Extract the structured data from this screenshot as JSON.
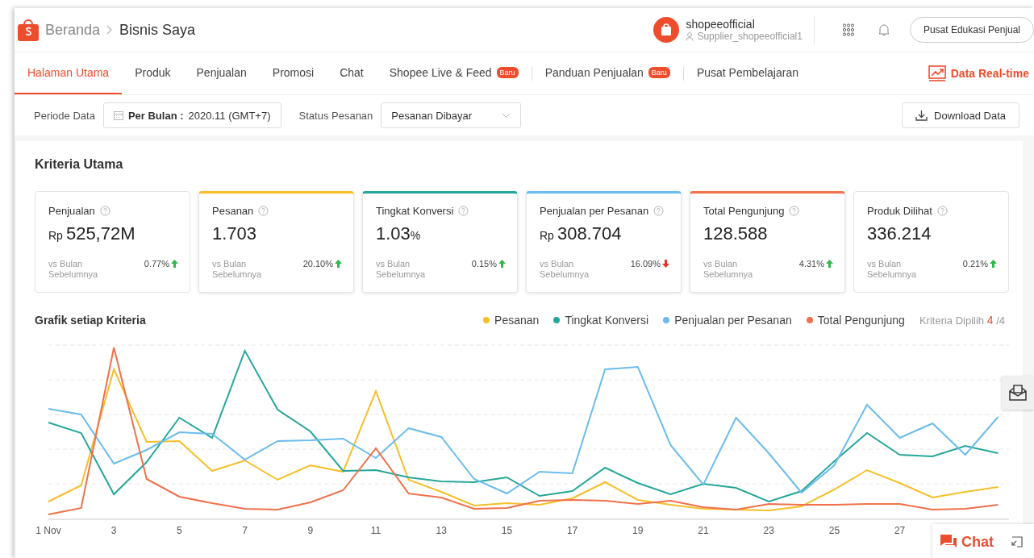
{
  "header": {
    "breadcrumb": [
      {
        "label": "Beranda"
      },
      {
        "label": "Bisnis Saya"
      }
    ],
    "shop": {
      "name": "shopeeofficial",
      "account": "Supplier_shopeeofficial1"
    },
    "edu_button": "Pusat Edukasi Penjual"
  },
  "nav": {
    "tabs": [
      {
        "label": "Halaman Utama",
        "selected": true
      },
      {
        "label": "Produk",
        "selected": false
      },
      {
        "label": "Penjualan",
        "selected": false
      },
      {
        "label": "Promosi",
        "selected": false
      },
      {
        "label": "Chat",
        "selected": false
      },
      {
        "label": "Shopee Live & Feed",
        "selected": false,
        "badge": "Baru"
      },
      {
        "label": "Panduan Penjualan",
        "selected": false,
        "badge": "Baru"
      },
      {
        "label": "Pusat Pembelajaran",
        "selected": false
      }
    ],
    "realtime": "Data Real-time"
  },
  "filters": {
    "period_label": "Periode Data",
    "period_mode": "Per Bulan :",
    "period_value": "2020.11 (GMT+7)",
    "status_label": "Status Pesanan",
    "status_value": "Pesanan Dibayar",
    "download": "Download Data"
  },
  "section_title": "Kriteria Utama",
  "metrics": [
    {
      "title": "Penjualan",
      "prefix": "Rp",
      "value": "525,72M",
      "compare": "vs Bulan Sebelumnya",
      "change": "0.77%",
      "up": true,
      "selected": false
    },
    {
      "title": "Pesanan",
      "value": "1.703",
      "compare": "vs Bulan Sebelumnya",
      "change": "20.10%",
      "up": true,
      "selected": true,
      "color": "#f5bf2a"
    },
    {
      "title": "Tingkat Konversi",
      "value": "1.03",
      "suffix": "%",
      "compare": "vs Bulan Sebelumnya",
      "change": "0.15%",
      "up": true,
      "selected": true,
      "color": "#26a69a"
    },
    {
      "title": "Penjualan per Pesanan",
      "prefix": "Rp",
      "value": "308.704",
      "compare": "vs Bulan Sebelumnya",
      "change": "16.09%",
      "up": false,
      "selected": true,
      "color": "#6bbcec"
    },
    {
      "title": "Total Pengunjung",
      "value": "128.588",
      "compare": "vs Bulan Sebelumnya",
      "change": "4.31%",
      "up": true,
      "selected": true,
      "color": "#f0714c"
    },
    {
      "title": "Produk Dilihat",
      "value": "336.214",
      "compare": "vs Bulan Sebelumnya",
      "change": "0.21%",
      "up": true,
      "selected": false
    }
  ],
  "chart": {
    "title": "Grafik setiap Kriteria",
    "legend": [
      {
        "label": "Pesanan",
        "color": "#f5bf2a"
      },
      {
        "label": "Tingkat Konversi",
        "color": "#26a69a"
      },
      {
        "label": "Penjualan per Pesanan",
        "color": "#6bbcec"
      },
      {
        "label": "Total Pengunjung",
        "color": "#f0714c"
      }
    ],
    "selected_label": "Kriteria Dipilih",
    "selected_count": "4",
    "selected_total": "/4",
    "x_labels": [
      "1 Nov",
      "3",
      "5",
      "7",
      "9",
      "11",
      "13",
      "15",
      "17",
      "19",
      "21",
      "23",
      "25",
      "27"
    ]
  },
  "chat": {
    "label": "Chat"
  }
}
